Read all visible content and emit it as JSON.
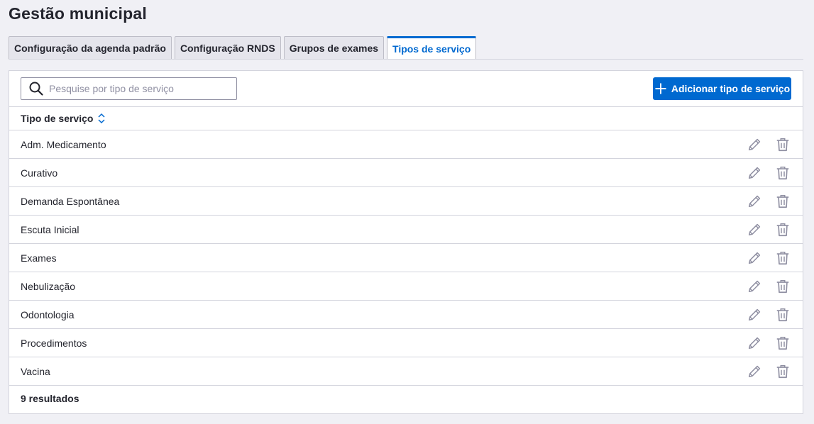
{
  "page": {
    "title": "Gestão municipal"
  },
  "tabs": [
    {
      "label": "Configuração da agenda padrão",
      "active": false
    },
    {
      "label": "Configuração RNDS",
      "active": false
    },
    {
      "label": "Grupos de exames",
      "active": false
    },
    {
      "label": "Tipos de serviço",
      "active": true
    }
  ],
  "search": {
    "placeholder": "Pesquise por tipo de serviço",
    "value": "",
    "icon": "search-icon"
  },
  "add_button": {
    "label": "Adicionar tipo de serviço",
    "icon": "plus-icon"
  },
  "table": {
    "column_header": "Tipo de serviço",
    "sort_icon": "sort-icon",
    "rows": [
      {
        "label": "Adm. Medicamento"
      },
      {
        "label": "Curativo"
      },
      {
        "label": "Demanda Espontânea"
      },
      {
        "label": "Escuta Inicial"
      },
      {
        "label": "Exames"
      },
      {
        "label": "Nebulização"
      },
      {
        "label": "Odontologia"
      },
      {
        "label": "Procedimentos"
      },
      {
        "label": "Vacina"
      }
    ],
    "row_actions": [
      "edit-icon",
      "delete-icon"
    ],
    "result_count": "9 resultados"
  },
  "colors": {
    "accent": "#0069d0",
    "text": "#24252e",
    "icon_gray": "#8f8fa2",
    "border": "#d3d4dd",
    "background": "#f0f0f5"
  }
}
